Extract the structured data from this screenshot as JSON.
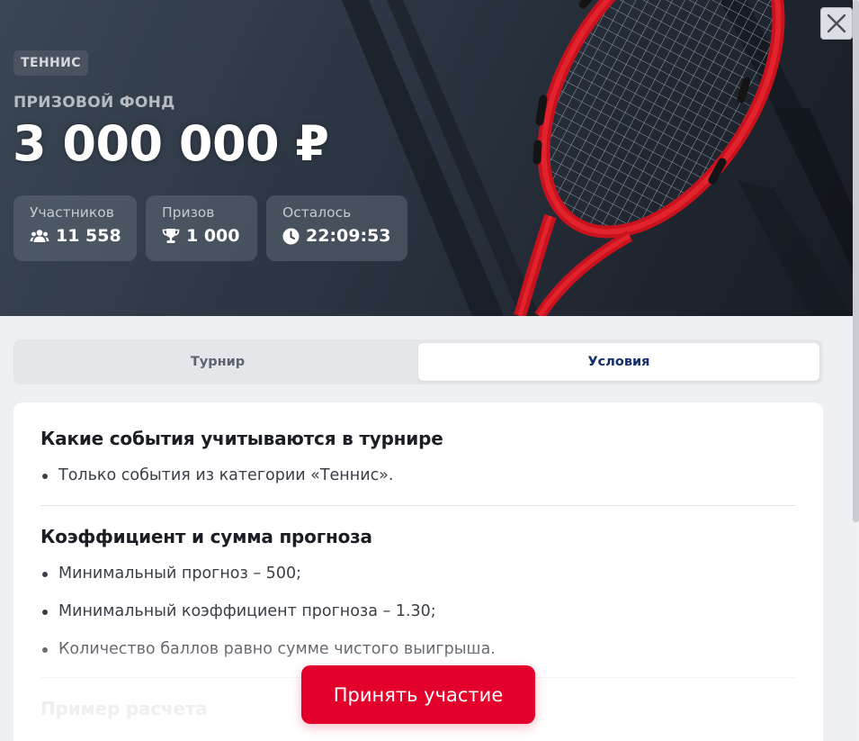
{
  "header": {
    "sport_badge": "ТЕННИС",
    "prize_label": "ПРИЗОВОЙ ФОНД",
    "prize_value": "3 000 000 ₽",
    "stats": [
      {
        "label": "Участников",
        "value": "11 558",
        "icon": "users-icon"
      },
      {
        "label": "Призов",
        "value": "1 000",
        "icon": "trophy-icon"
      },
      {
        "label": "Осталось",
        "value": "22:09:53",
        "icon": "clock-icon"
      }
    ]
  },
  "tabs": [
    {
      "label": "Турнир",
      "active": false
    },
    {
      "label": "Условия",
      "active": true
    }
  ],
  "conditions": {
    "sections": [
      {
        "title": "Какие события учитываются в турнире",
        "items": [
          "Только события из категории «Теннис»."
        ]
      },
      {
        "title": "Коэффициент и сумма прогноза",
        "items": [
          "Минимальный прогноз – 500;",
          "Минимальный коэффициент прогноза – 1.30;",
          "Количество баллов равно сумме чистого выигрыша."
        ]
      },
      {
        "title": "Пример расчета",
        "items": []
      }
    ]
  },
  "cta": {
    "label": "Принять участие"
  },
  "colors": {
    "accent": "#e3002b",
    "active_tab_text": "#13306b",
    "hero_dark": "#2b3441"
  }
}
